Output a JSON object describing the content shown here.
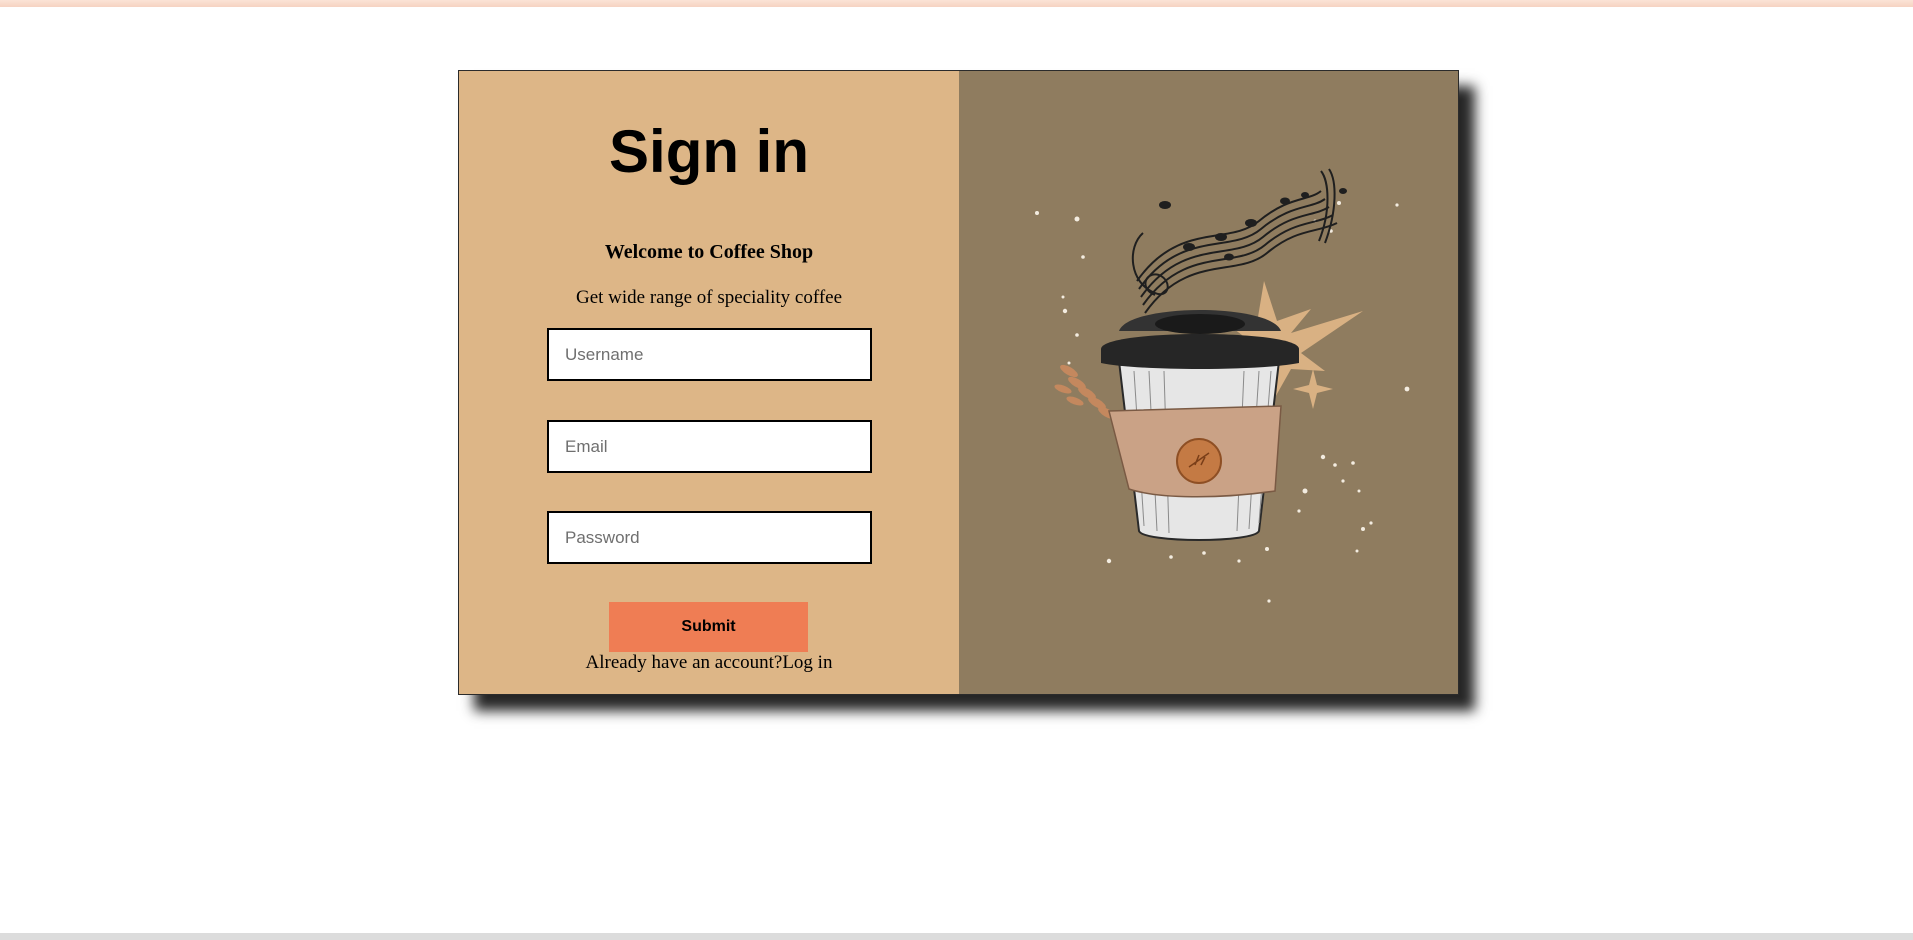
{
  "form": {
    "title": "Sign in",
    "welcome": "Welcome to Coffee Shop",
    "tagline": "Get wide range of speciality coffee",
    "username_placeholder": "Username",
    "email_placeholder": "Email",
    "password_placeholder": "Password",
    "submit_label": "Submit",
    "account_prompt": "Already have an account?",
    "login_link": "Log in"
  },
  "colors": {
    "left_panel": "#ddb687",
    "right_panel": "#8f7c5f",
    "submit_button": "#ef7d54"
  },
  "illustration": {
    "icon": "coffee-cup-with-music-notes-illustration"
  }
}
